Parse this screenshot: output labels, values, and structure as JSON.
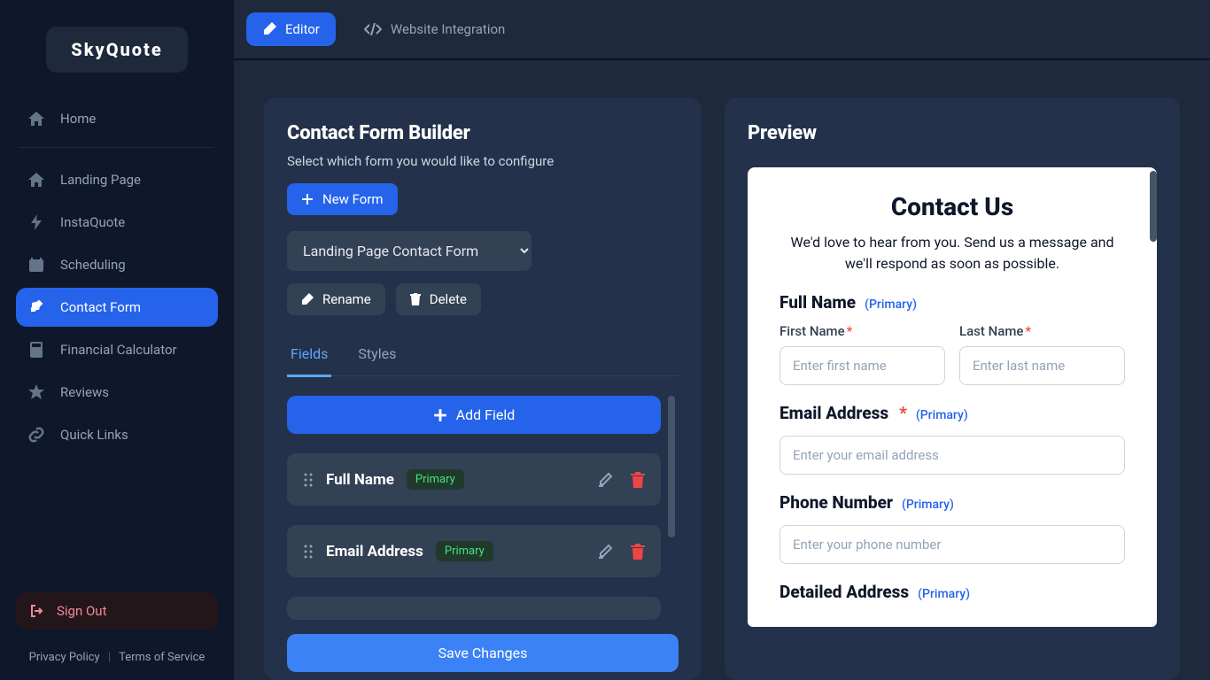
{
  "app": {
    "name": "SkyQuote"
  },
  "sidebar": {
    "items": [
      {
        "label": "Home"
      },
      {
        "label": "Landing Page"
      },
      {
        "label": "InstaQuote"
      },
      {
        "label": "Scheduling"
      },
      {
        "label": "Contact Form"
      },
      {
        "label": "Financial Calculator"
      },
      {
        "label": "Reviews"
      },
      {
        "label": "Quick Links"
      }
    ],
    "signout": "Sign Out"
  },
  "footer": {
    "privacy": "Privacy Policy",
    "terms": "Terms of Service"
  },
  "topbar": {
    "editor": "Editor",
    "integration": "Website Integration"
  },
  "builder": {
    "title": "Contact Form Builder",
    "subtitle": "Select which form you would like to configure",
    "new_form": "New Form",
    "select_value": "Landing Page Contact Form",
    "rename": "Rename",
    "delete": "Delete",
    "tabs": {
      "fields": "Fields",
      "styles": "Styles"
    },
    "add_field": "Add Field",
    "save": "Save Changes",
    "fields": [
      {
        "label": "Full Name",
        "badge": "Primary"
      },
      {
        "label": "Email Address",
        "badge": "Primary"
      }
    ]
  },
  "preview": {
    "heading": "Preview",
    "card": {
      "title": "Contact Us",
      "desc": "We'd love to hear from you. Send us a message and we'll respond as soon as possible.",
      "primary_tag": "(Primary)",
      "full_name": {
        "heading": "Full Name",
        "first": {
          "label": "First Name",
          "placeholder": "Enter first name"
        },
        "last": {
          "label": "Last Name",
          "placeholder": "Enter last name"
        }
      },
      "email": {
        "heading": "Email Address",
        "placeholder": "Enter your email address"
      },
      "phone": {
        "heading": "Phone Number",
        "placeholder": "Enter your phone number"
      },
      "address": {
        "heading": "Detailed Address"
      }
    }
  }
}
